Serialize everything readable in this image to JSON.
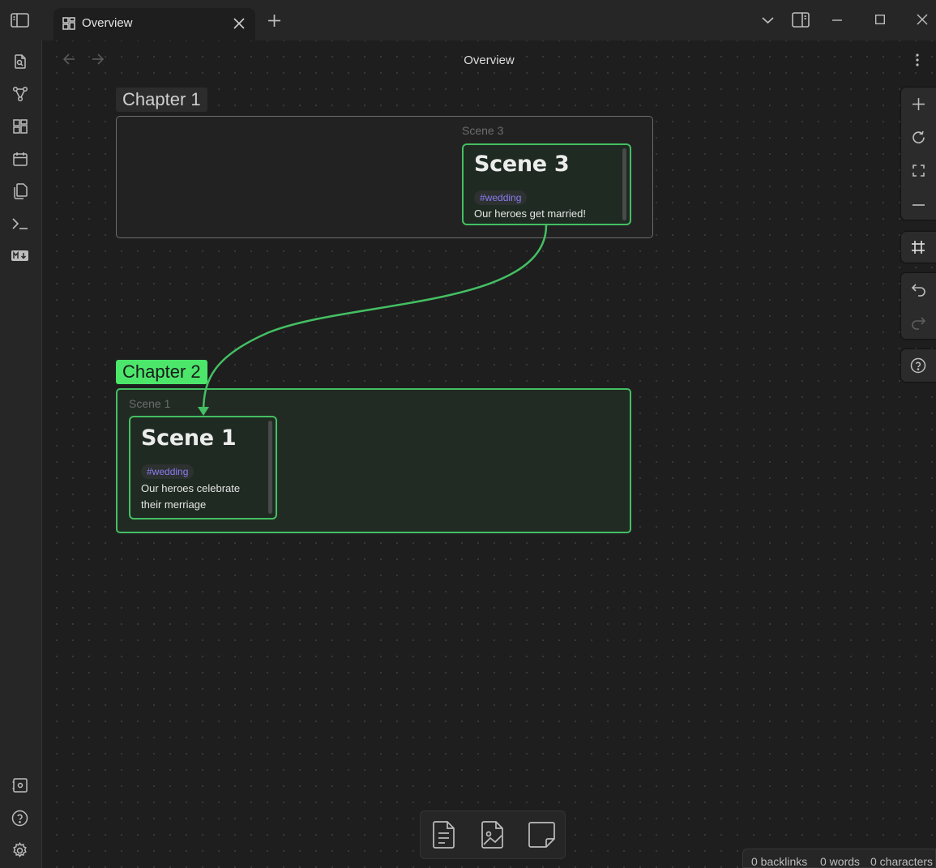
{
  "tab": {
    "title": "Overview"
  },
  "view": {
    "title": "Overview"
  },
  "groups": [
    {
      "label": "Chapter 1"
    },
    {
      "label": "Chapter 2"
    }
  ],
  "nodes": [
    {
      "file_label": "Scene 3",
      "heading": "Scene 3",
      "tag": "#wedding",
      "text": "Our heroes get married!"
    },
    {
      "file_label": "Scene 1",
      "heading": "Scene 1",
      "tag": "#wedding",
      "text_line1": "Our heroes celebrate",
      "text_line2": "their merriage"
    }
  ],
  "status": {
    "backlinks": "0 backlinks",
    "words": "0 words",
    "characters": "0 characters"
  },
  "colors": {
    "accent_green": "#44bf63",
    "chapter2_label_bg": "#4ce66b",
    "tag_text": "#8a7cf0"
  },
  "icons": {
    "titlebar": [
      "sidebar-toggle-icon",
      "canvas-tab-icon",
      "close-tab-icon",
      "new-tab-icon",
      "tab-list-chevron-icon",
      "right-sidebar-icon",
      "minimize-icon",
      "maximize-icon",
      "close-window-icon"
    ],
    "ribbon": [
      "quick-switcher-icon",
      "graph-view-icon",
      "canvas-icon",
      "daily-notes-icon",
      "templates-icon",
      "command-palette-icon",
      "markdown-importer-icon",
      "vault-icon",
      "help-icon",
      "settings-icon"
    ],
    "canvas_controls": [
      "zoom-in-icon",
      "reset-zoom-icon",
      "zoom-to-fit-icon",
      "zoom-out-icon",
      "snap-grid-icon",
      "undo-icon",
      "redo-icon",
      "canvas-help-icon"
    ],
    "bottom": [
      "add-note-icon",
      "add-media-icon",
      "add-card-icon"
    ]
  }
}
